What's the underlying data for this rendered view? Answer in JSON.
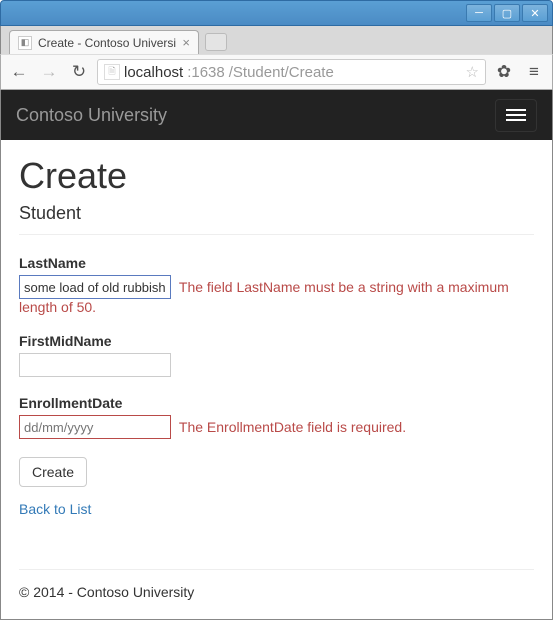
{
  "window": {
    "tab_title": "Create - Contoso Universit",
    "url_host": "localhost",
    "url_port": ":1638",
    "url_path": "/Student/Create"
  },
  "navbar": {
    "brand": "Contoso University"
  },
  "page": {
    "heading": "Create",
    "subheading": "Student"
  },
  "form": {
    "lastname": {
      "label": "LastName",
      "value": "some load of old rubbish",
      "error": "The field LastName must be a string with a maximum length of 50."
    },
    "firstmidname": {
      "label": "FirstMidName",
      "value": ""
    },
    "enrollmentdate": {
      "label": "EnrollmentDate",
      "placeholder": "dd/mm/yyyy",
      "error": "The EnrollmentDate field is required."
    },
    "submit_label": "Create",
    "back_link": "Back to List"
  },
  "footer": {
    "text": "© 2014 - Contoso University"
  }
}
